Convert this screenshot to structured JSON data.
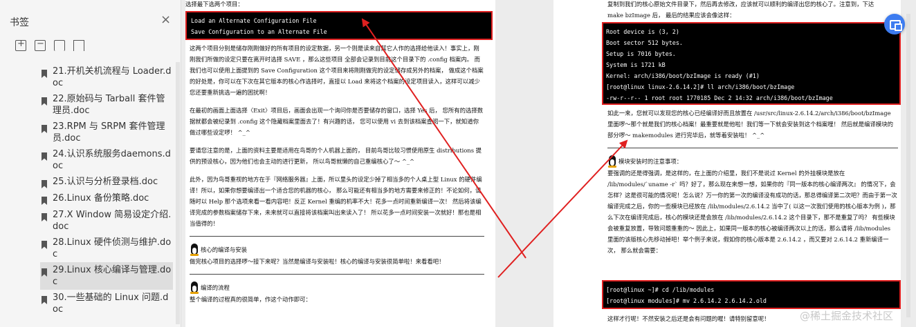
{
  "sidebar": {
    "title": "书签",
    "close": "×",
    "items": [
      {
        "label": "21.开机关机流程与 Loader.doc"
      },
      {
        "label": "22.原始码与 Tarball 套件管理员.doc"
      },
      {
        "label": "23.RPM 与 SRPM 套件管理员.doc"
      },
      {
        "label": "24.认识系统服务daemons.doc"
      },
      {
        "label": "25.认识与分析登录档.doc"
      },
      {
        "label": "26.Linux 备份策略.doc"
      },
      {
        "label": "27.X Window 简易设定介绍.doc"
      },
      {
        "label": "28.Linux 硬件侦测与维护.doc"
      },
      {
        "label": "29.Linux 核心编译与管理.doc"
      },
      {
        "label": "30.一些基础的 Linux 问题.doc"
      }
    ],
    "active_index": 8
  },
  "left_page": {
    "top_line": "选择最下选两个项目：",
    "box_lines": [
      "Load an Alternate Configuration File",
      "Save Configuration to an Alternate File"
    ],
    "paragraphs": [
      "这两个项目分别是储存刚刚做好的所有项目的设定数据，另一个则是读来自其它人作的选择给他读入！事实上，刚刚我们所做的设定只要在离开时选择 SAVE ，那么这些项目 全部会记录到目前这个目录下的 .config 档案内。 而我们也可以使用上面提到的 Save Configuration 这个项目来将刚刚做完的设定储存成另外的档案， 做成这个档案的好处是，你可以在下次在其它版本的核心作选择时，直接以 Load 来将这个档案的设定项目读入，这样可以减少您还要重新挑选一遍的困扰啊！",
      "在最初的画面上面选择〈Exit〉项目后，画面会出现一个询问你是否要储存的窗口，选择 Yes 后， 您所有的选择数据就都会被纪录到 .config 这个隐藏档案里面去了！有兴趣的话， 您可以使用 vi 去到该档案查阅一下，就知道你做过哪些设定啰！ ^_^",
      "要请您注意的是，上面的资料主要是适用在鸟哥的个人机器上面的， 目前鸟哥比较习惯使用原生 distributions 提供的预设核心，因为他们也会主动的进行更新， 所以鸟哥就懒的自己重编核心了～ ^_^",
      "此外，因为鸟哥重视的地方在于『网络服务器』上面，所以里头的设定少掉了相当多的个人桌上型 Linux 的硬件编译！所以，如果你想要编译出一个适合您的机器的核心， 那么可能还有相当多的地方需要来修正的！不论如何，请随时以 Help 那个选项来看一看内容吧！反正 Kernel 重编的机率不大！花多一点时间重新编译一次！ 然后将该编译完成的参数档案储存下来，未来就可以直接将该档案叫出来读入了！ 所以花多一点时间安装一次就好！那也是相当值得的！"
    ],
    "section1_title": "核心的编译与安装",
    "section1_text": "做完核心项目的选择啰～接下来呢？当然是编译与安装啦！核心的编译与安装很简单啦！来看看吧！",
    "section2_title": "编译的流程",
    "section2_text": "整个编译的过程真的很简单，作这个动作即可："
  },
  "right_page": {
    "head_lines": [
      "复制到我们的核心原始文件目录下，然后再去修改，应该就可以顺利的编译出您的核心了。注意到，下达",
      "make bzImage 后， 最后的结果应该会像这样："
    ],
    "box1_lines": [
      "Root device is (3, 2)",
      "Boot sector 512 bytes.",
      "Setup is 7016 bytes.",
      "System is 1721 kB",
      "Kernel: arch/i386/boot/bzImage is ready  (#1)",
      "[root@linux linux-2.6.14.2]# ll arch/i386/boot/bzImage",
      "-rw-r--r--  1 root root 1770185 Dec  2 14:32 arch/i386/boot/bzImage"
    ],
    "para1": "如此一来，您就可以发现您的核心已经编译好而且放置在 /usr/src/linux-2.6.14.2/arch/i386/boot/bzImage 里面啰～那个就是我们的核心档案！最重要就是他啦！我们等一下就会安装到这个档案哩！ 然后就是编译模块的部分啰～ makemodules 进行完毕后，就等着安装啦！ ^_^",
    "section_title": "模块安装时的注意事项：",
    "para2": "要强调的还是得强调，是这样的，在上面的介绍里，我们不是说过 Kernel 的外挂模块是放在 /lib/modules/`uname -r` 吗？好了，那么现在来想一想，如果你的『同一版本的核心编译两次』 的情况下，会怎样？这是很可能的情况呢！怎么说？万一你的第一次的编译没有成功的话，那总得编译第二次吧？而由于第一次编译完成之后，你的一些模块已经放在 /lib/modules/2.6.14.2 当中了( 以这一次我们使用的核心版本为例 )，那么下次在编译完成后，核心的模块还是会放在 /lib/modules/2.6.14.2 这个目录下，那不是重复了吗？ 有些模块会被重复放置，导致问题重重的～ 因此上，如果同一版本的核心被编译两次以上的话，那么请将 /lib/modules 里面的该版核心先移动掉吧！举个例子来说，假如你的核心版本是 2.6.14.2 ，而又要对 2.6.14.2 重新编译一次， 那么就会需要：",
    "box2_lines": [
      "[root@linux ~]# cd /lib/modules",
      "[root@linux modules]# mv 2.6.14.2 2.6.14.2.old"
    ],
    "tail": "这样才行呢！不然安装之后还是会有问题的喔！请特别留意呢！"
  },
  "watermark": "@稀土掘金技术社区",
  "colors": {
    "highlight_box": "#e02020",
    "arrow": "#e02020",
    "float_button": "#3d7cf0"
  }
}
